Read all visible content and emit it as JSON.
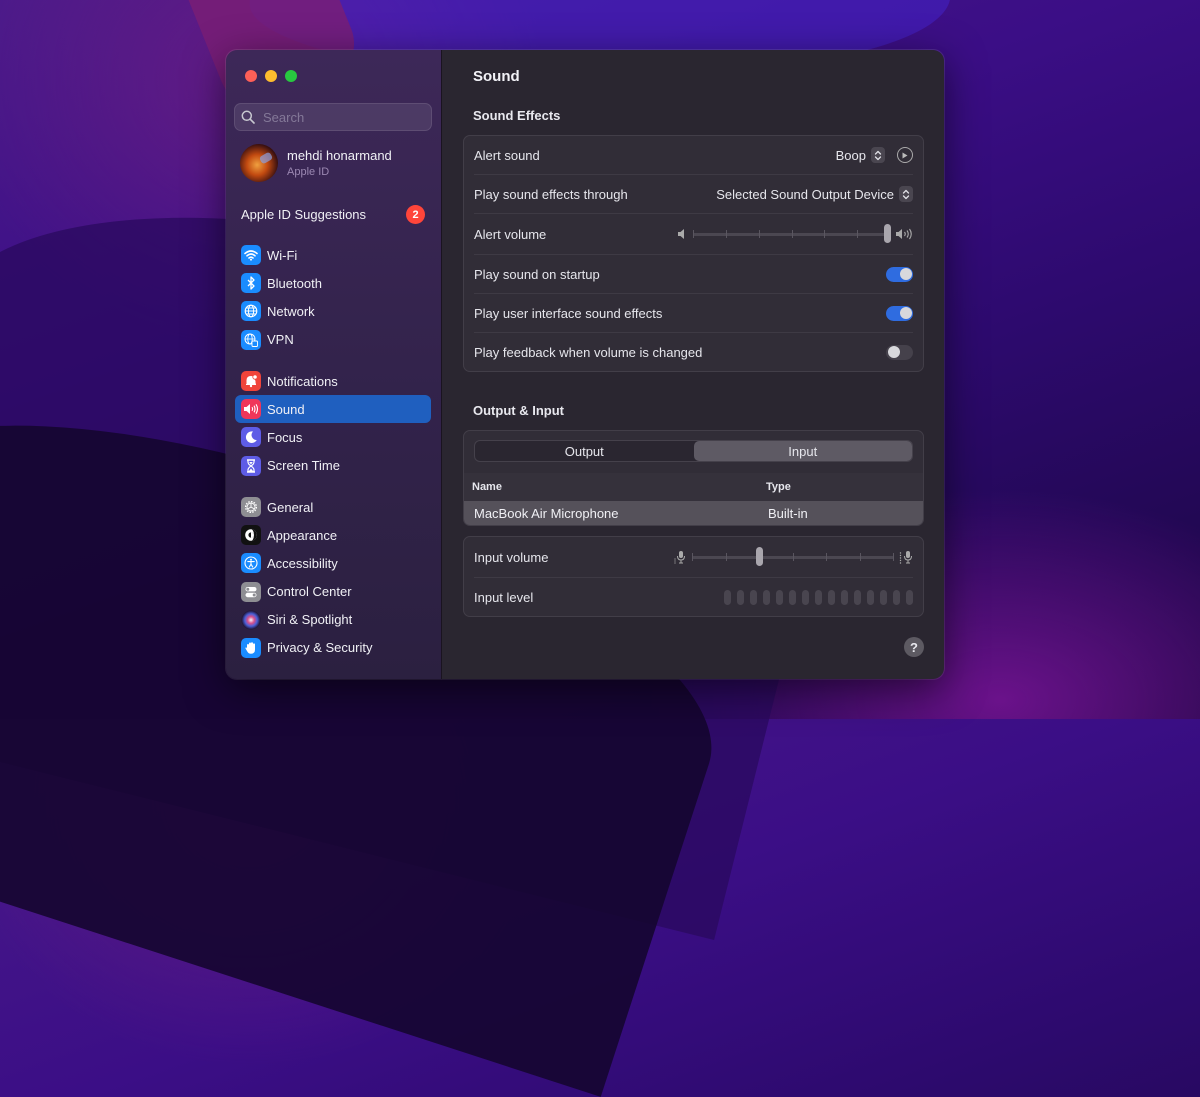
{
  "window": {
    "title": "Sound"
  },
  "sidebar": {
    "search_placeholder": "Search",
    "profile": {
      "name": "mehdi honarmand",
      "subtitle": "Apple ID"
    },
    "suggestions": {
      "label": "Apple ID Suggestions",
      "badge": "2"
    },
    "groups": [
      [
        {
          "label": "Wi-Fi",
          "icon": "wifi-icon",
          "color": "#1a8cff"
        },
        {
          "label": "Bluetooth",
          "icon": "bluetooth-icon",
          "color": "#1a8cff"
        },
        {
          "label": "Network",
          "icon": "globe-icon",
          "color": "#1a8cff"
        },
        {
          "label": "VPN",
          "icon": "vpn-icon",
          "color": "#1a8cff"
        }
      ],
      [
        {
          "label": "Notifications",
          "icon": "bell-icon",
          "color": "#f0443a"
        },
        {
          "label": "Sound",
          "icon": "speaker-icon",
          "color": "#f0365a",
          "active": true
        },
        {
          "label": "Focus",
          "icon": "moon-icon",
          "color": "#5e5ce6"
        },
        {
          "label": "Screen Time",
          "icon": "hourglass-icon",
          "color": "#5e5ce6"
        }
      ],
      [
        {
          "label": "General",
          "icon": "gear-icon",
          "color": "#8e8e93"
        },
        {
          "label": "Appearance",
          "icon": "appearance-icon",
          "color": "#111111"
        },
        {
          "label": "Accessibility",
          "icon": "accessibility-icon",
          "color": "#1a8cff"
        },
        {
          "label": "Control Center",
          "icon": "control-center-icon",
          "color": "#8e8e93"
        },
        {
          "label": "Siri & Spotlight",
          "icon": "siri-icon",
          "color": "#b03070"
        },
        {
          "label": "Privacy & Security",
          "icon": "hand-icon",
          "color": "#1a8cff"
        }
      ]
    ]
  },
  "main": {
    "title": "Sound",
    "sound_effects": {
      "heading": "Sound Effects",
      "alert_sound": {
        "label": "Alert sound",
        "value": "Boop"
      },
      "play_through": {
        "label": "Play sound effects through",
        "value": "Selected Sound Output Device"
      },
      "alert_volume": {
        "label": "Alert volume",
        "value_fraction": 1.0,
        "ticks": 7
      },
      "startup": {
        "label": "Play sound on startup",
        "on": true
      },
      "ui_sounds": {
        "label": "Play user interface sound effects",
        "on": true
      },
      "feedback": {
        "label": "Play feedback when volume is changed",
        "on": false
      }
    },
    "output_input": {
      "heading": "Output & Input",
      "tabs": [
        {
          "label": "Output",
          "active": false
        },
        {
          "label": "Input",
          "active": true
        }
      ],
      "table": {
        "columns": [
          "Name",
          "Type"
        ],
        "rows": [
          {
            "name": "MacBook Air Microphone",
            "type": "Built-in",
            "selected": true
          }
        ]
      },
      "input_volume": {
        "label": "Input volume",
        "value_fraction": 0.33,
        "ticks": 7
      },
      "input_level": {
        "label": "Input level",
        "bars": 15,
        "lit": 0
      }
    },
    "help_label": "?"
  },
  "colors": {
    "accent": "#1f5fbf",
    "toggle_on": "#2f6ce0",
    "badge": "#ff453a"
  }
}
